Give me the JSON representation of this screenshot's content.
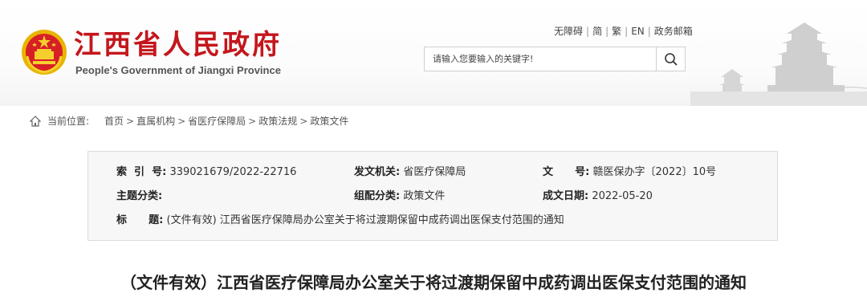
{
  "header": {
    "site_title": "江西省人民政府",
    "site_subtitle": "People's Government of Jiangxi Province",
    "links": [
      "无障碍",
      "简",
      "繁",
      "EN",
      "政务邮箱"
    ],
    "link_separator": "|",
    "search_placeholder": "请输入您要输入的关键字!"
  },
  "breadcrumb": {
    "label": "当前位置:",
    "items": [
      "首页",
      "直属机构",
      "省医疗保障局",
      "政策法规",
      "政策文件"
    ],
    "separator": ">"
  },
  "info": {
    "index_no_label": "索  引  号:",
    "index_no": "339021679/2022-22716",
    "issuer_label": "发文机关:",
    "issuer": "省医疗保障局",
    "doc_no_label": "文      号:",
    "doc_no": "赣医保办字〔2022〕10号",
    "topic_label": "主题分类:",
    "topic": "",
    "category_label": "组配分类:",
    "category": "政策文件",
    "date_label": "成文日期:",
    "date": "2022-05-20",
    "title_label": "标      题:",
    "title": "(文件有效) 江西省医疗保障局办公室关于将过渡期保留中成药调出医保支付范围的通知"
  },
  "document": {
    "title": "（文件有效）江西省医疗保障局办公室关于将过渡期保留中成药调出医保支付范围的通知"
  },
  "colors": {
    "brand_red": "#c4161c",
    "emblem_gold": "#e8b400"
  }
}
